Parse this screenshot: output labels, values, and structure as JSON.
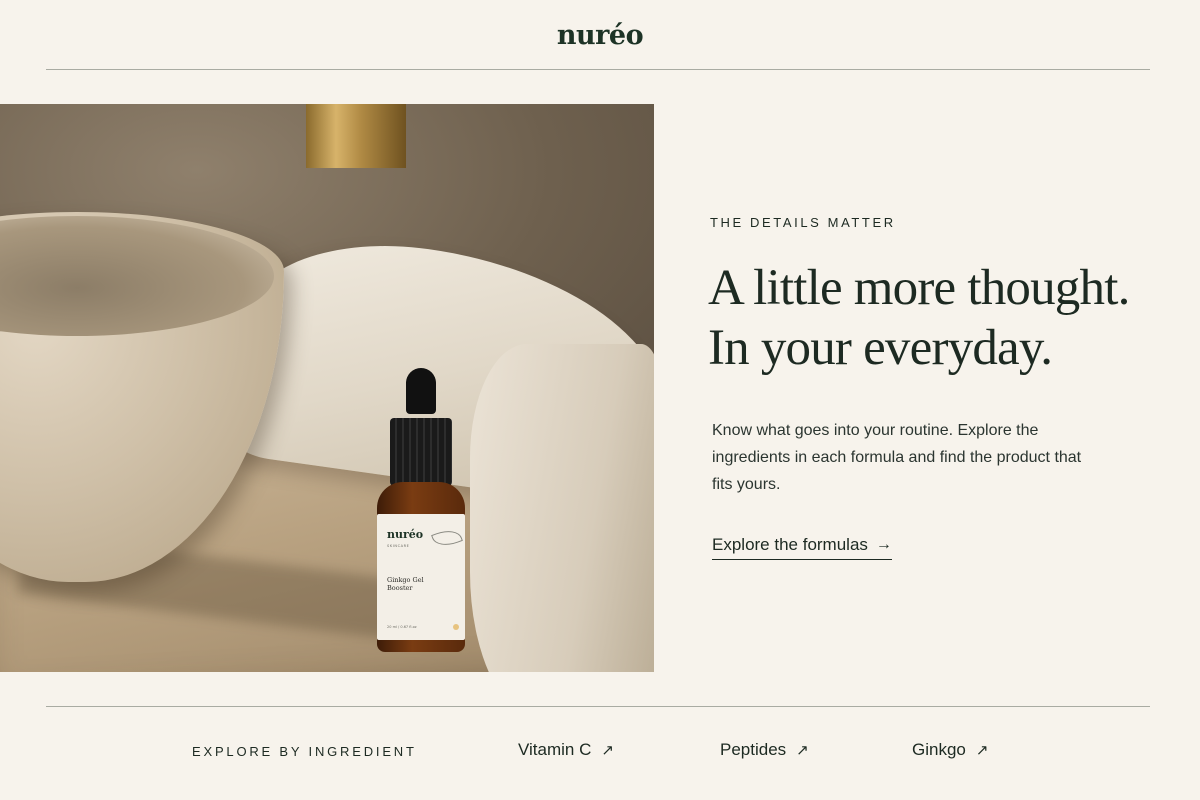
{
  "header": {
    "logo": "nuréo"
  },
  "hero": {
    "image_alt": "Ginkgo Gel Booster bottle on a stone countertop beside a basin and linen towel",
    "bottle_label": {
      "brand": "nuréo",
      "sub": "SKINCARE",
      "product": "Ginkgo Gel Booster",
      "volume": "20 ml / 0.67 fl.oz"
    }
  },
  "content": {
    "eyebrow": "THE DETAILS MATTER",
    "headline_line1": "A little more thought.",
    "headline_line2": "In your everyday.",
    "body": "Know what goes into your routine. Explore the ingredients in each formula and find the product that fits yours.",
    "cta_label": "Explore the formulas",
    "cta_arrow": "→"
  },
  "footer": {
    "label": "EXPLORE BY INGREDIENT",
    "ingredients": [
      {
        "label": "Vitamin C",
        "arrow": "↗"
      },
      {
        "label": "Peptides",
        "arrow": "↗"
      },
      {
        "label": "Ginkgo",
        "arrow": "↗"
      }
    ]
  },
  "colors": {
    "background": "#f7f3ec",
    "text": "#1d2a22",
    "rule": "#a9aba2"
  }
}
